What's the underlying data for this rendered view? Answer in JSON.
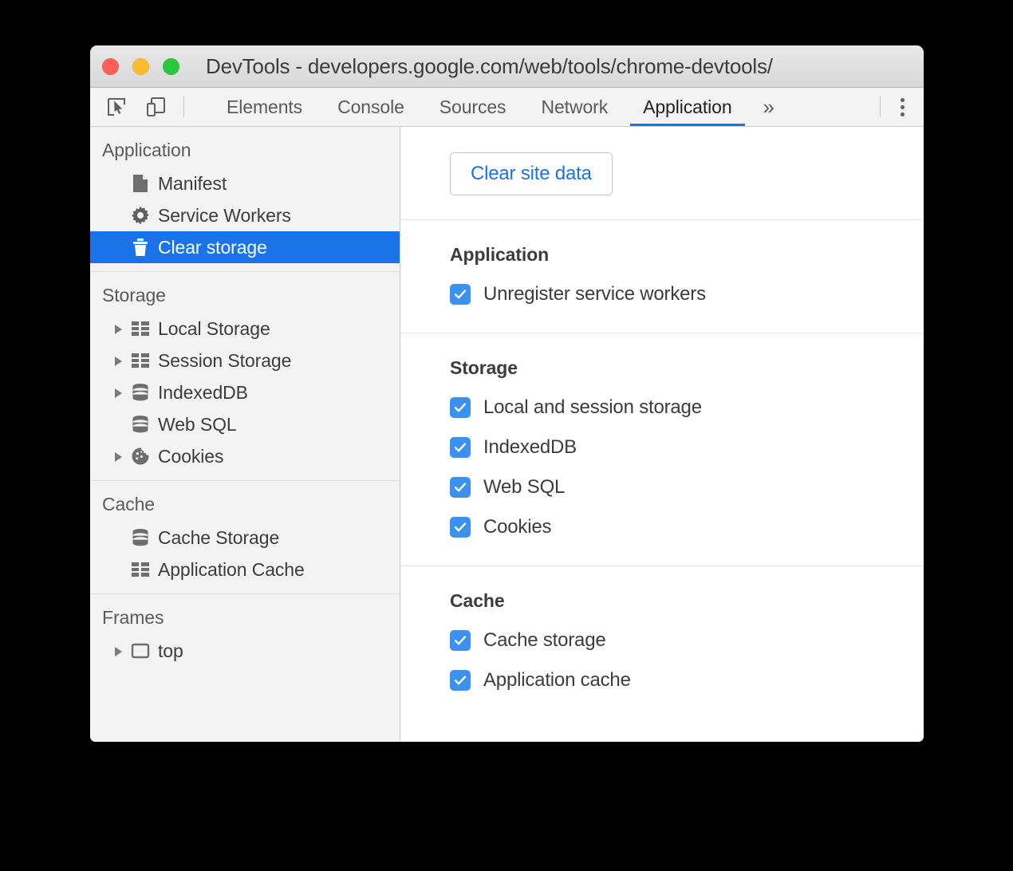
{
  "window": {
    "title": "DevTools - developers.google.com/web/tools/chrome-devtools/",
    "traffic_lights": {
      "close_color": "#FF5F57",
      "minimize_color": "#FEBC2E",
      "maximize_color": "#28C840"
    }
  },
  "toolbar": {
    "icons": [
      {
        "name": "inspect-element-icon",
        "label": "Inspect element"
      },
      {
        "name": "device-toolbar-icon",
        "label": "Toggle device toolbar"
      }
    ],
    "menu_icon": "more-vertical-icon"
  },
  "tabs": [
    {
      "label": "Elements",
      "active": false
    },
    {
      "label": "Console",
      "active": false
    },
    {
      "label": "Sources",
      "active": false
    },
    {
      "label": "Network",
      "active": false
    },
    {
      "label": "Application",
      "active": true
    }
  ],
  "tab_overflow_label": "»",
  "accent_color": "#1A73E8",
  "sidebar": {
    "groups": [
      {
        "title": "Application",
        "items": [
          {
            "label": "Manifest",
            "icon": "document-icon",
            "twisty": false,
            "selected": false
          },
          {
            "label": "Service Workers",
            "icon": "gear-icon",
            "twisty": false,
            "selected": false
          },
          {
            "label": "Clear storage",
            "icon": "trash-icon",
            "twisty": false,
            "selected": true
          }
        ]
      },
      {
        "title": "Storage",
        "items": [
          {
            "label": "Local Storage",
            "icon": "table-icon",
            "twisty": true,
            "selected": false
          },
          {
            "label": "Session Storage",
            "icon": "table-icon",
            "twisty": true,
            "selected": false
          },
          {
            "label": "IndexedDB",
            "icon": "database-icon",
            "twisty": true,
            "selected": false
          },
          {
            "label": "Web SQL",
            "icon": "database-icon",
            "twisty": false,
            "selected": false
          },
          {
            "label": "Cookies",
            "icon": "cookie-icon",
            "twisty": true,
            "selected": false
          }
        ]
      },
      {
        "title": "Cache",
        "items": [
          {
            "label": "Cache Storage",
            "icon": "database-icon",
            "twisty": false,
            "selected": false
          },
          {
            "label": "Application Cache",
            "icon": "table-icon",
            "twisty": false,
            "selected": false
          }
        ]
      },
      {
        "title": "Frames",
        "items": [
          {
            "label": "top",
            "icon": "frame-icon",
            "twisty": true,
            "selected": false
          }
        ]
      }
    ]
  },
  "main": {
    "clear_site_data_label": "Clear site data",
    "sections": [
      {
        "heading": "Application",
        "options": [
          {
            "label": "Unregister service workers",
            "checked": true
          }
        ]
      },
      {
        "heading": "Storage",
        "options": [
          {
            "label": "Local and session storage",
            "checked": true
          },
          {
            "label": "IndexedDB",
            "checked": true
          },
          {
            "label": "Web SQL",
            "checked": true
          },
          {
            "label": "Cookies",
            "checked": true
          }
        ]
      },
      {
        "heading": "Cache",
        "options": [
          {
            "label": "Cache storage",
            "checked": true
          },
          {
            "label": "Application cache",
            "checked": true
          }
        ]
      }
    ]
  }
}
